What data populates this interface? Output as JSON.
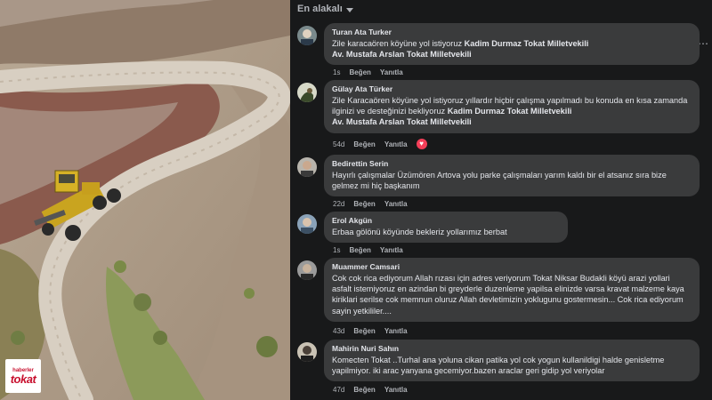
{
  "page": {
    "logo": {
      "small": "haberler",
      "main": "tokat"
    },
    "sort_label": "En alakalı"
  },
  "comments": [
    {
      "author": "Turan Ata Turker",
      "text": "Zile karacaören köyüne yol istiyoruz",
      "tag1": "Kadim Durmaz Tokat Milletvekili",
      "tag2": "Av. Mustafa Arslan Tokat Milletvekili",
      "time": "1s",
      "like": "Beğen",
      "reply": "Yanıtla"
    },
    {
      "author": "Gülay Ata Türker",
      "text": "Zile Karacaören köyüne yol istiyoruz yıllardır hiçbir çalışma yapılmadı bu konuda en kısa zamanda ilginizi ve desteğinizi bekliyoruz",
      "tag1": "Kadim Durmaz Tokat Milletvekili",
      "tag2": "Av. Mustafa Arslan Tokat Milletvekili",
      "time": "54d",
      "like": "Beğen",
      "reply": "Yanıtla",
      "reaction": "heart"
    },
    {
      "author": "Bedirettin Serin",
      "text": "Hayırlı çalışmalar Üzümören Artova yolu parke çalışmaları yarım kaldı bir el atsanız sıra bize gelmez mi hiç başkanım",
      "time": "22d",
      "like": "Beğen",
      "reply": "Yanıtla"
    },
    {
      "author": "Erol Akgün",
      "text": "Erbaa gölönü köyünde bekleriz yollarımız berbat",
      "time": "1s",
      "like": "Beğen",
      "reply": "Yanıtla"
    },
    {
      "author": "Muammer Camsari",
      "text": "Cok cok rica ediyorum Allah rızası için adres veriyorum Tokat Niksar Budakli köyü arazi yollari asfalt istemiyoruz en azindan bi greyderle duzenleme yapilsa elinizde varsa kravat malzeme kaya kiriklari serilse cok memnun oluruz Allah devletimizin yoklugunu gostermesin... Cok rica ediyorum sayin yetkililer....",
      "time": "43d",
      "like": "Beğen",
      "reply": "Yanıtla"
    },
    {
      "author": "Mahirin Nuri Sahın",
      "text": "Komecten Tokat ..Turhal ana yoluna cikan patika yol cok yogun kullanildigi halde genisletme yapilmiyor. iki arac yanyana gecemiyor.bazen araclar geri gidip yol veriyolar",
      "time": "47d",
      "like": "Beğen",
      "reply": "Yanıtla"
    }
  ]
}
